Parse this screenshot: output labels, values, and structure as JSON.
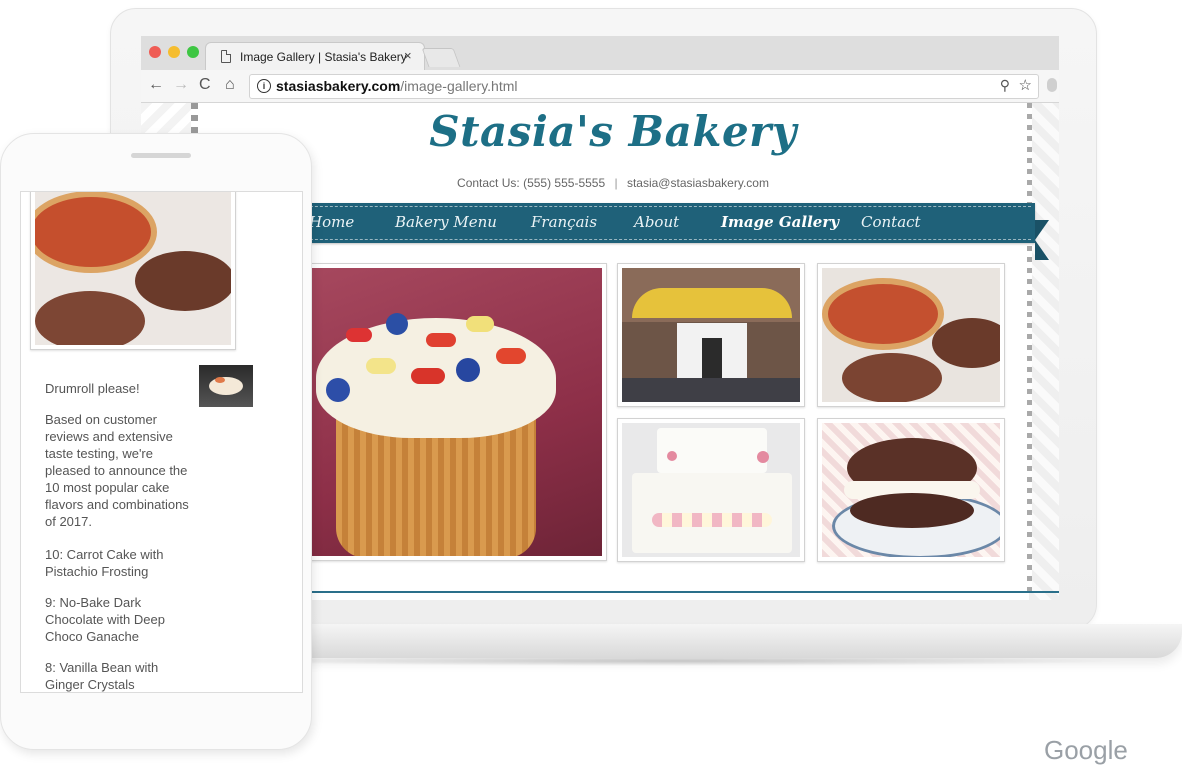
{
  "browser": {
    "tab_title": "Image Gallery | Stasia's Bakery",
    "tab_close": "×",
    "url_domain": "stasiasbakery.com",
    "url_path": "/image-gallery.html",
    "icons": [
      "back-arrow-icon",
      "forward-arrow-icon",
      "reload-icon",
      "home-icon",
      "info-icon",
      "zoom-icon",
      "star-icon"
    ],
    "traffic_lights": [
      "#ef5c55",
      "#f5bd2f",
      "#3ec643"
    ]
  },
  "site": {
    "brand": "Stasia's Bakery",
    "contact_label": "Contact Us:",
    "phone": "(555) 555-5555",
    "separator": "|",
    "email": "stasia@stasiasbakery.com",
    "accent_color": "#1f6179",
    "nav": [
      {
        "label": "Home",
        "active": false
      },
      {
        "label": "Bakery Menu",
        "active": false
      },
      {
        "label": "Français",
        "active": false
      },
      {
        "label": "About",
        "active": false
      },
      {
        "label": "Image Gallery",
        "active": true
      },
      {
        "label": "Contact",
        "active": false
      }
    ],
    "gallery": [
      "cupcake",
      "bakery-storefront",
      "tarts-on-stand",
      "wedding-cake",
      "whoopie-pie"
    ]
  },
  "phone": {
    "heading": "Drumroll please!",
    "intro": "Based on customer reviews and extensive taste testing, we're pleased to announce the 10 most popular cake flavors and combinations of 2017.",
    "items": [
      "10: Carrot Cake with Pistachio Frosting",
      "9:  No-Bake Dark Chocolate with Deep Choco Ganache",
      "8:  Vanilla Bean with Ginger Crystals"
    ]
  },
  "footer_word": "Google"
}
